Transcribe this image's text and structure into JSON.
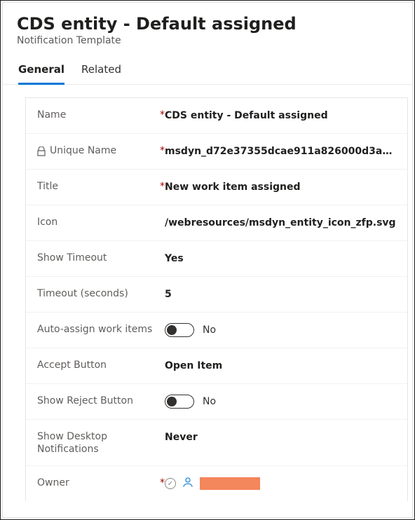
{
  "header": {
    "title": "CDS entity - Default assigned",
    "subtitle": "Notification Template"
  },
  "tabs": {
    "general": "General",
    "related": "Related",
    "active": "general"
  },
  "fields": {
    "name": {
      "label": "Name",
      "value": "CDS entity - Default assigned",
      "required": true,
      "locked": false
    },
    "uniqueName": {
      "label": "Unique Name",
      "value": "msdyn_d72e37355dcae911a826000d3a…",
      "required": true,
      "locked": true
    },
    "titleField": {
      "label": "Title",
      "value": "New work item assigned",
      "required": true,
      "locked": false
    },
    "icon": {
      "label": "Icon",
      "value": "/webresources/msdyn_entity_icon_zfp.svg",
      "required": false,
      "locked": false
    },
    "showTimeout": {
      "label": "Show Timeout",
      "value": "Yes",
      "required": false,
      "locked": false
    },
    "timeout": {
      "label": "Timeout (seconds)",
      "value": "5",
      "required": false,
      "locked": false
    },
    "autoAssign": {
      "label": "Auto-assign work items",
      "value": "No",
      "required": false,
      "locked": false
    },
    "acceptBtn": {
      "label": "Accept Button",
      "value": "Open Item",
      "required": false,
      "locked": false
    },
    "showReject": {
      "label": "Show Reject Button",
      "value": "No",
      "required": false,
      "locked": false
    },
    "showDesktop": {
      "label": "Show Desktop Notifications",
      "value": "Never",
      "required": false,
      "locked": false
    },
    "owner": {
      "label": "Owner",
      "value": "",
      "required": true,
      "locked": false
    }
  },
  "icons": {
    "lock": "🔒",
    "clock": "◷",
    "person": "person"
  }
}
